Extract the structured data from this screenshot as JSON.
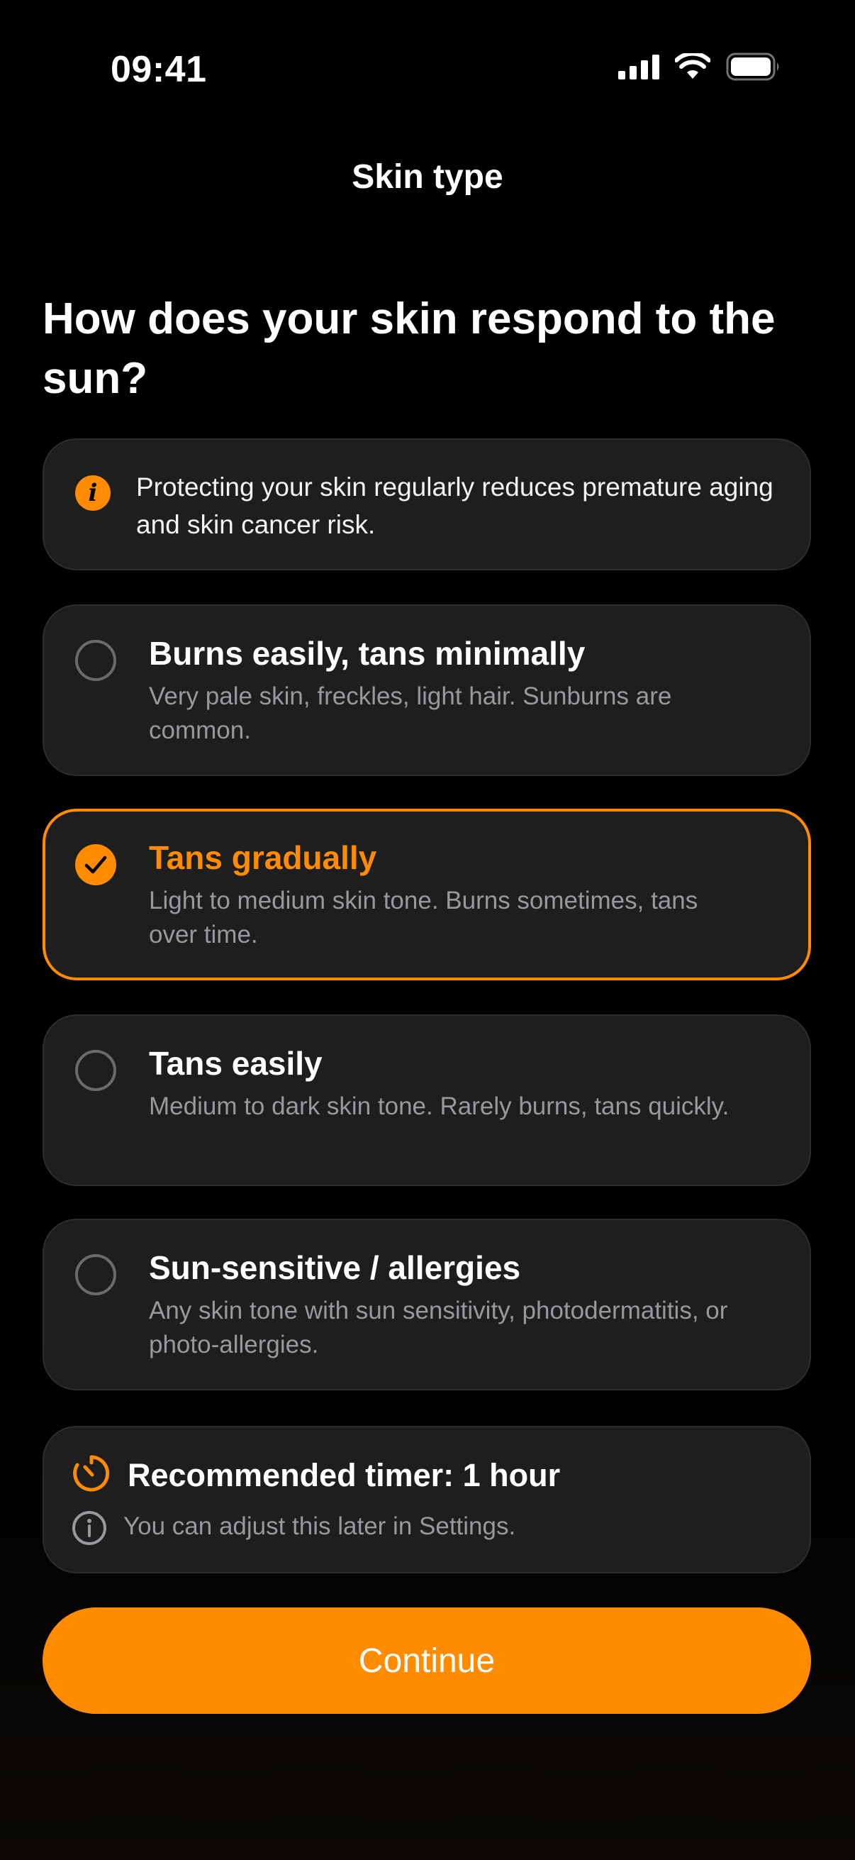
{
  "status_bar": {
    "time": "09:41"
  },
  "nav": {
    "title": "Skin type"
  },
  "question": "How does your skin respond to the sun?",
  "info": {
    "text": "Protecting your skin regularly reduces premature aging and skin cancer risk."
  },
  "options": [
    {
      "title": "Burns easily, tans minimally",
      "description": "Very pale skin, freckles, light hair. Sunburns are common.",
      "selected": false
    },
    {
      "title": "Tans gradually",
      "description": "Light to medium skin tone. Burns sometimes, tans over time.",
      "selected": true
    },
    {
      "title": "Tans easily",
      "description": "Medium to dark skin tone. Rarely burns, tans quickly.",
      "selected": false
    },
    {
      "title": "Sun-sensitive / allergies",
      "description": "Any skin tone with sun sensitivity, photodermatitis, or photo-allergies.",
      "selected": false
    }
  ],
  "timer": {
    "title": "Recommended timer: 1 hour",
    "note": "You can adjust this later in Settings."
  },
  "continue_label": "Continue",
  "colors": {
    "accent": "#ff8c00",
    "card": "#1e1e1f",
    "muted_text": "#98989e",
    "background": "#000000"
  }
}
